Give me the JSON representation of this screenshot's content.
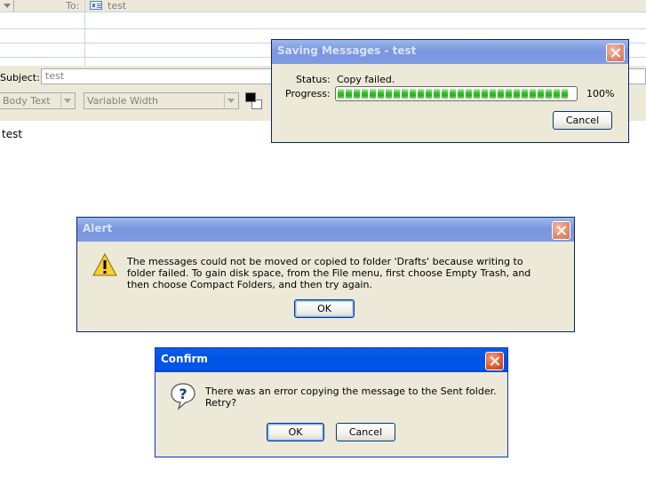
{
  "compose": {
    "to_label": "To:",
    "to_value": "test",
    "subject_label": "Subject:",
    "subject_value": "test",
    "paragraph_style": "Body Text",
    "font_face": "Variable Width",
    "body": "test"
  },
  "saving_dialog": {
    "title": "Saving Messages - test",
    "status_label": "Status:",
    "status_value": "Copy failed.",
    "progress_label": "Progress:",
    "progress_value": 1.0,
    "progress_text": "100%",
    "cancel_label": "Cancel"
  },
  "alert_dialog": {
    "title": "Alert",
    "icon": "warning-icon",
    "message": "The messages could not be moved or copied to folder 'Drafts' because writing to folder failed. To gain disk space, from the File menu, first choose Empty Trash, and then choose Compact Folders, and then try again.",
    "ok_label": "OK"
  },
  "confirm_dialog": {
    "title": "Confirm",
    "icon": "question-icon",
    "message": "There was an error copying the message to the Sent folder. Retry?",
    "ok_label": "OK",
    "cancel_label": "Cancel"
  },
  "colors": {
    "dialog_bg": "#ece9d8",
    "active_title": "#0054e3",
    "inactive_title": "#7a96df",
    "progress_green": "#38c030"
  }
}
